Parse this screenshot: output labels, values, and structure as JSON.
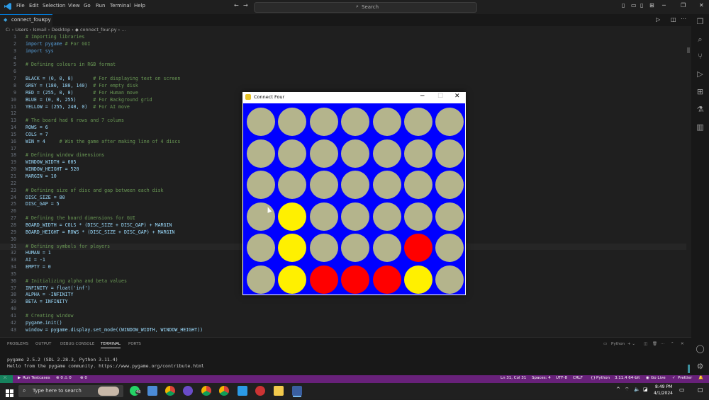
{
  "menu": [
    "File",
    "Edit",
    "Selection",
    "View",
    "Go",
    "Run",
    "Terminal",
    "Help"
  ],
  "search": {
    "placeholder": "Search"
  },
  "tab": {
    "label": "connect_four.py",
    "close": "×"
  },
  "breadcrumb": "C: › Users › Ismail › Desktop › ◆ connect_four.py › ...",
  "code_lines": [
    {
      "n": "1",
      "t": "# Importing libraries",
      "k": "comment"
    },
    {
      "n": "2",
      "t": "import pygame # For GUI",
      "k": "kw"
    },
    {
      "n": "3",
      "t": "import sys",
      "k": "kw"
    },
    {
      "n": "4",
      "t": "",
      "k": "plain"
    },
    {
      "n": "5",
      "t": "# Defining colours in RGB format",
      "k": "comment"
    },
    {
      "n": "6",
      "t": "",
      "k": "plain"
    },
    {
      "n": "7",
      "t": "BLACK = (0, 0, 0)       # For displaying text on screen",
      "k": "ident"
    },
    {
      "n": "8",
      "t": "GREY = (180, 180, 140)  # For empty disk",
      "k": "ident"
    },
    {
      "n": "9",
      "t": "RED = (255, 0, 0)       # For Human move",
      "k": "ident"
    },
    {
      "n": "10",
      "t": "BLUE = (0, 0, 255)      # For Background grid",
      "k": "ident"
    },
    {
      "n": "11",
      "t": "YELLOW = (255, 240, 0)  # For AI move",
      "k": "ident"
    },
    {
      "n": "12",
      "t": "",
      "k": "plain"
    },
    {
      "n": "13",
      "t": "# The board had 6 rows and 7 colums",
      "k": "comment"
    },
    {
      "n": "14",
      "t": "ROWS = 6",
      "k": "ident"
    },
    {
      "n": "15",
      "t": "COLS = 7",
      "k": "ident"
    },
    {
      "n": "16",
      "t": "WIN = 4     # Win the game after making line of 4 discs",
      "k": "ident"
    },
    {
      "n": "17",
      "t": "",
      "k": "plain"
    },
    {
      "n": "18",
      "t": "# Defining window dimensions",
      "k": "comment"
    },
    {
      "n": "19",
      "t": "WINDOW_WIDTH = 605",
      "k": "ident"
    },
    {
      "n": "20",
      "t": "WINDOW_HEIGHT = 520",
      "k": "ident"
    },
    {
      "n": "21",
      "t": "MARGIN = 10",
      "k": "ident"
    },
    {
      "n": "22",
      "t": "",
      "k": "plain"
    },
    {
      "n": "23",
      "t": "# Defining size of disc and gap between each disk",
      "k": "comment"
    },
    {
      "n": "24",
      "t": "DISC_SIZE = 80",
      "k": "ident"
    },
    {
      "n": "25",
      "t": "DISC_GAP = 5",
      "k": "ident"
    },
    {
      "n": "26",
      "t": "",
      "k": "plain"
    },
    {
      "n": "27",
      "t": "# Defining the board dimensions for GUI",
      "k": "comment"
    },
    {
      "n": "28",
      "t": "BOARD_WIDTH = COLS * (DISC_SIZE + DISC_GAP) + MARGIN",
      "k": "ident"
    },
    {
      "n": "29",
      "t": "BOARD_HEIGHT = ROWS * (DISC_SIZE + DISC_GAP) + MARGIN",
      "k": "ident"
    },
    {
      "n": "30",
      "t": "",
      "k": "plain"
    },
    {
      "n": "31",
      "t": "# Defining symbols for players",
      "k": "comment"
    },
    {
      "n": "32",
      "t": "HUMAN = 1",
      "k": "ident"
    },
    {
      "n": "33",
      "t": "AI = -1",
      "k": "ident"
    },
    {
      "n": "34",
      "t": "EMPTY = 0",
      "k": "ident"
    },
    {
      "n": "35",
      "t": "",
      "k": "plain"
    },
    {
      "n": "36",
      "t": "# Initializing alpha and beta values",
      "k": "comment"
    },
    {
      "n": "37",
      "t": "INFINITY = float('inf')",
      "k": "ident"
    },
    {
      "n": "38",
      "t": "ALPHA = -INFINITY",
      "k": "ident"
    },
    {
      "n": "39",
      "t": "BETA = INFINITY",
      "k": "ident"
    },
    {
      "n": "40",
      "t": "",
      "k": "plain"
    },
    {
      "n": "41",
      "t": "# Creating window",
      "k": "comment"
    },
    {
      "n": "42",
      "t": "pygame.init()",
      "k": "ident"
    },
    {
      "n": "43",
      "t": "window = pygame.display.set_mode((WINDOW_WIDTH, WINDOW_HEIGHT))",
      "k": "ident"
    }
  ],
  "panel": {
    "tabs": [
      "PROBLEMS",
      "OUTPUT",
      "DEBUG CONSOLE",
      "TERMINAL",
      "PORTS"
    ],
    "shell": "Python",
    "terminal_lines": [
      "pygame 2.5.2 (SDL 2.28.3, Python 3.11.4)",
      "Hello from the pygame community. https://www.pygame.org/contribute.html"
    ]
  },
  "statusbar": {
    "run": "Run Testcases",
    "problems": "⊗ 0 ⚠ 0",
    "ports": "⊗ 0",
    "position": "Ln 31, Col 31",
    "spaces": "Spaces: 4",
    "encoding": "UTF-8",
    "eol": "CRLF",
    "language": "Python",
    "interpreter": "3.11.4 64-bit",
    "golive": "Go Live",
    "prettier": "Prettier"
  },
  "taskbar": {
    "search_placeholder": "Type here to search",
    "time": "8:49 PM",
    "date": "4/1/2024",
    "badge": "48"
  },
  "game": {
    "title": "Connect Four",
    "colors": {
      "BLUE": "#0000ff",
      "GREY": "#b4b48c",
      "RED": "#ff0000",
      "YELLOW": "#fff000"
    },
    "board": [
      [
        "E",
        "E",
        "E",
        "E",
        "E",
        "E",
        "E"
      ],
      [
        "E",
        "E",
        "E",
        "E",
        "E",
        "E",
        "E"
      ],
      [
        "E",
        "E",
        "E",
        "E",
        "E",
        "E",
        "E"
      ],
      [
        "E",
        "Y",
        "E",
        "E",
        "E",
        "E",
        "E"
      ],
      [
        "E",
        "Y",
        "E",
        "E",
        "E",
        "R",
        "E"
      ],
      [
        "E",
        "Y",
        "R",
        "R",
        "R",
        "Y",
        "E"
      ]
    ]
  }
}
